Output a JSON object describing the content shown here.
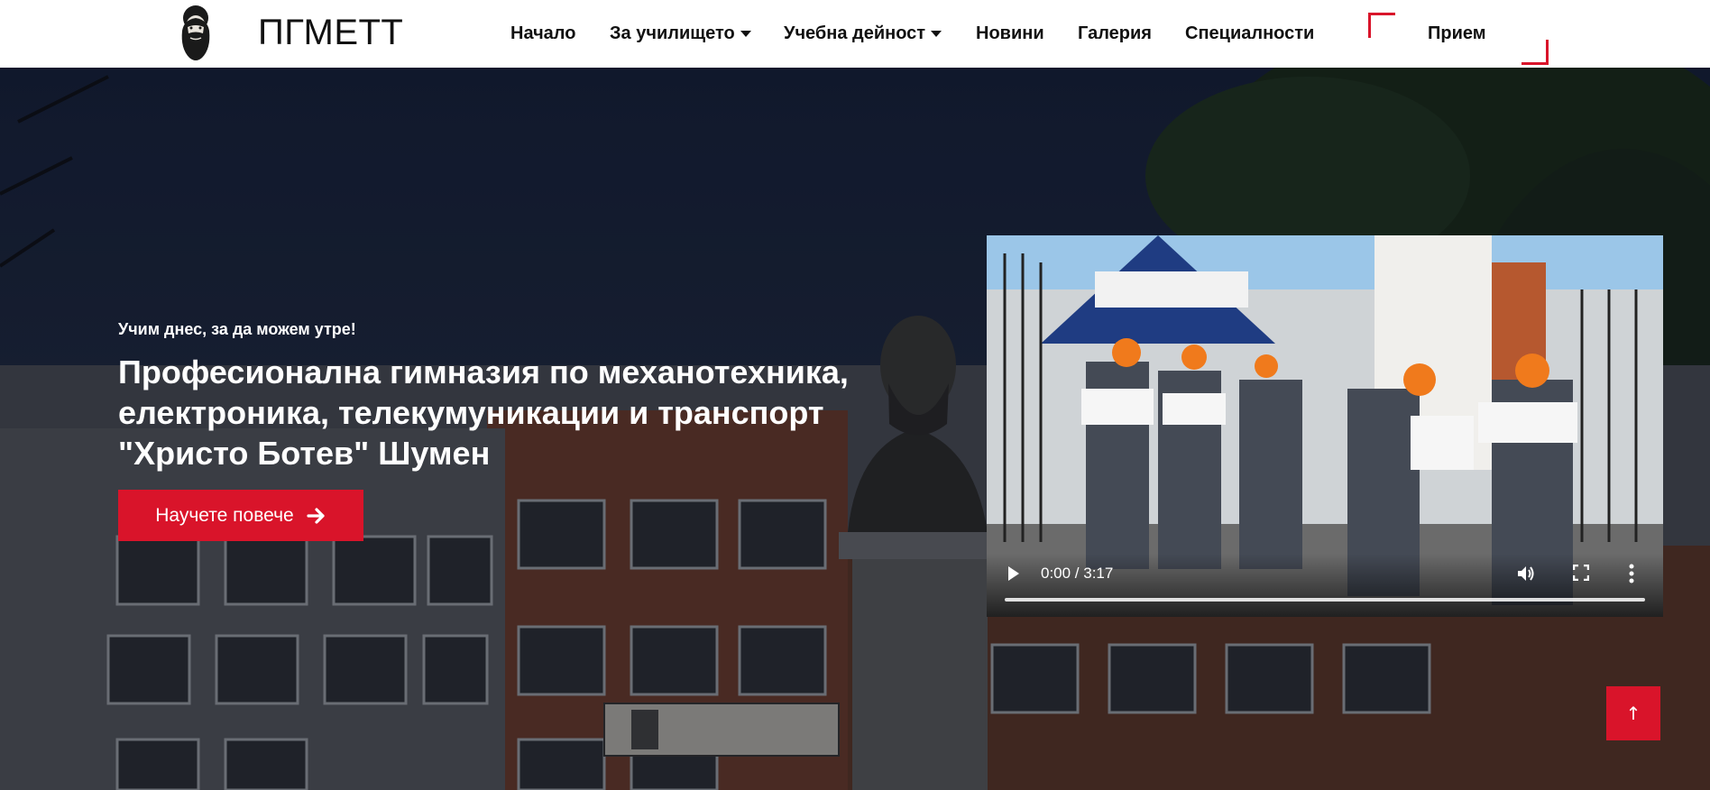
{
  "brand": {
    "name": "ПГМЕТТ",
    "logo_icon": "botev-portrait-icon"
  },
  "nav": {
    "items": [
      {
        "label": "Начало",
        "dropdown": false
      },
      {
        "label": "За училището",
        "dropdown": true
      },
      {
        "label": "Учебна дейност",
        "dropdown": true
      },
      {
        "label": "Новини",
        "dropdown": false
      },
      {
        "label": "Галерия",
        "dropdown": false
      },
      {
        "label": "Специалности",
        "dropdown": false
      }
    ],
    "cta": "Прием"
  },
  "hero": {
    "tagline": "Учим днес, за да можем утре!",
    "title": "Професионална гимназия по механотехника, електроника, телекумуникации и транспорт \"Христо Ботев\" Шумен",
    "button_label": "Научете повече",
    "button_icon": "arrow-right-icon"
  },
  "video": {
    "time": "0:00 / 3:17",
    "progress": 0.0,
    "icons": [
      "play-icon",
      "volume-icon",
      "fullscreen-icon",
      "more-options-icon"
    ]
  },
  "back_to_top": {
    "icon": "arrow-up-icon",
    "glyph": "↑"
  },
  "colors": {
    "accent": "#d9142a",
    "nav_text": "#111111",
    "hero_text": "#ffffff"
  }
}
